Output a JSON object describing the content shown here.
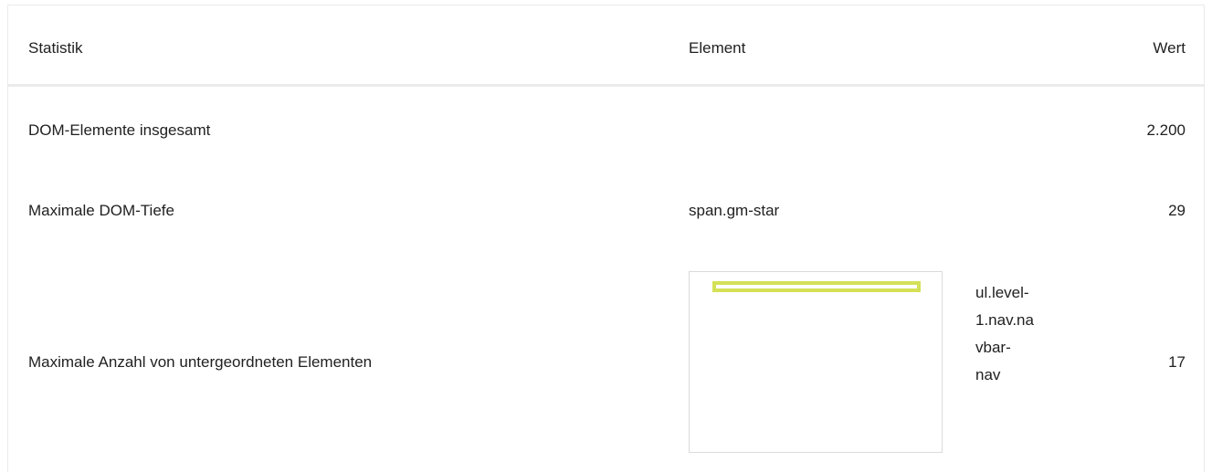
{
  "header": {
    "col_statistik": "Statistik",
    "col_element": "Element",
    "col_wert": "Wert"
  },
  "rows": [
    {
      "statistik": "DOM-Elemente insgesamt",
      "element": "",
      "wert": "2.200"
    },
    {
      "statistik": "Maximale DOM-Tiefe",
      "element": "span.gm-star",
      "wert": "29"
    },
    {
      "statistik": "Maximale Anzahl von untergeordneten Elementen",
      "element": "ul.level-\n1.nav.na\nvbar-\nnav",
      "wert": "17"
    }
  ],
  "colors": {
    "highlight": "#d4e157",
    "border": "#ebebeb"
  }
}
